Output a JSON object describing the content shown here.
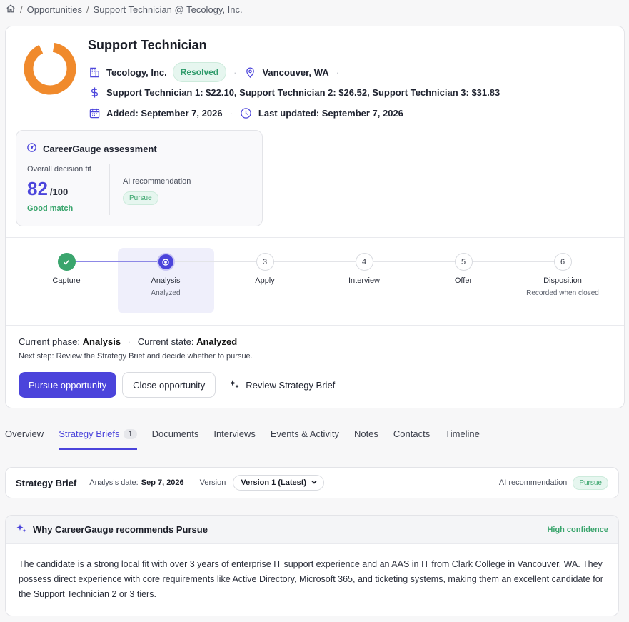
{
  "breadcrumb": {
    "items": [
      "Opportunities",
      "Support Technician @ Tecology, Inc."
    ]
  },
  "header": {
    "title": "Support Technician",
    "company": "Tecology, Inc.",
    "status": "Resolved",
    "location": "Vancouver, WA",
    "salary": "Support Technician 1: $22.10, Support Technician 2: $26.52, Support Technician 3: $31.83",
    "added": "Added: September 7, 2026",
    "updated": "Last updated: September 7, 2026"
  },
  "assessment": {
    "title": "CareerGauge assessment",
    "fit_label": "Overall decision fit",
    "score": "82",
    "score_max": "/100",
    "match": "Good match",
    "rec_label": "AI recommendation",
    "rec_value": "Pursue"
  },
  "stepper": {
    "steps": [
      {
        "num": "",
        "label": "Capture",
        "sub": ""
      },
      {
        "num": "",
        "label": "Analysis",
        "sub": "Analyzed"
      },
      {
        "num": "3",
        "label": "Apply",
        "sub": ""
      },
      {
        "num": "4",
        "label": "Interview",
        "sub": ""
      },
      {
        "num": "5",
        "label": "Offer",
        "sub": ""
      },
      {
        "num": "6",
        "label": "Disposition",
        "sub": "Recorded when closed"
      }
    ]
  },
  "phase": {
    "phase_label": "Current phase:",
    "phase_value": "Analysis",
    "state_label": "Current state:",
    "state_value": "Analyzed",
    "next_step": "Next step: Review the Strategy Brief and decide whether to pursue."
  },
  "actions": {
    "pursue": "Pursue opportunity",
    "close": "Close opportunity",
    "review": "Review Strategy Brief"
  },
  "tabs": [
    {
      "label": "Overview"
    },
    {
      "label": "Strategy Briefs",
      "count": "1"
    },
    {
      "label": "Documents"
    },
    {
      "label": "Interviews"
    },
    {
      "label": "Events & Activity"
    },
    {
      "label": "Notes"
    },
    {
      "label": "Contacts"
    },
    {
      "label": "Timeline"
    }
  ],
  "brief": {
    "title": "Strategy Brief",
    "date_label": "Analysis date:",
    "date_value": "Sep 7, 2026",
    "version_label": "Version",
    "version_value": "Version 1 (Latest)",
    "rec_label": "AI recommendation",
    "rec_value": "Pursue"
  },
  "why": {
    "title": "Why CareerGauge recommends Pursue",
    "confidence": "High confidence",
    "body": "The candidate is a strong local fit with over 3 years of enterprise IT support experience and an AAS in IT from Clark College in Vancouver, WA. They possess direct experience with core requirements like Active Directory, Microsoft 365, and ticketing systems, making them an excellent candidate for the Support Technician 2 or 3 tiers."
  },
  "colors": {
    "accent": "#4b44db",
    "success": "#3aa56d",
    "logo": "#f08a2c"
  }
}
